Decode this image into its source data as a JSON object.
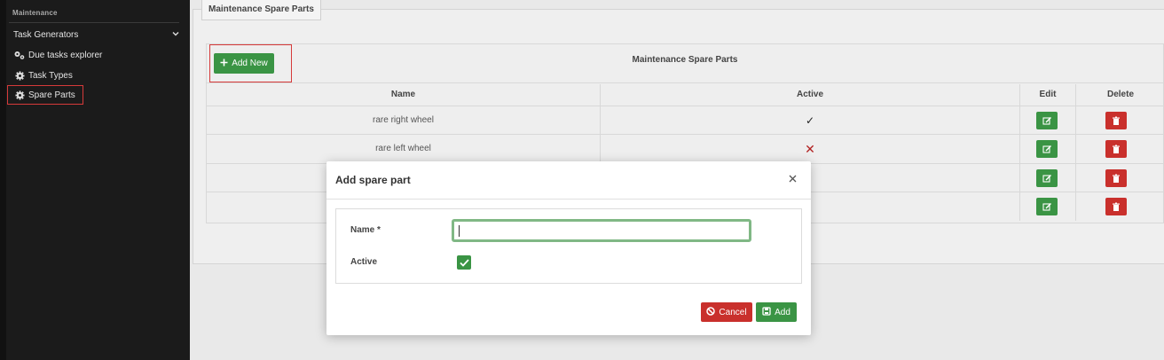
{
  "sidebar": {
    "section_title": "Maintenance",
    "items": [
      {
        "label": "Task Generators",
        "icon": "chevron-down-icon"
      },
      {
        "label": "Due tasks explorer",
        "icon": "gears-icon"
      },
      {
        "label": "Task Types",
        "icon": "gear-icon"
      },
      {
        "label": "Spare Parts",
        "icon": "gear-icon",
        "active": true
      }
    ]
  },
  "main": {
    "tab_label": "Maintenance Spare Parts",
    "grid": {
      "title": "Maintenance Spare Parts",
      "add_new_label": "Add New",
      "columns": [
        "Name",
        "Active",
        "Edit",
        "Delete"
      ],
      "rows": [
        {
          "name": "rare right wheel",
          "active": "✓"
        },
        {
          "name": "rare left wheel",
          "active": "✕"
        },
        {
          "name": "",
          "active": ""
        },
        {
          "name": "",
          "active": ""
        }
      ]
    }
  },
  "modal": {
    "title": "Add spare part",
    "name_label": "Name *",
    "name_value": "",
    "active_label": "Active",
    "active_checked": true,
    "cancel_label": "Cancel",
    "add_label": "Add"
  },
  "colors": {
    "green": "#3a9444",
    "red": "#c9302c",
    "highlight": "#d63a3a",
    "sidebar_bg": "#1b1b1b"
  }
}
